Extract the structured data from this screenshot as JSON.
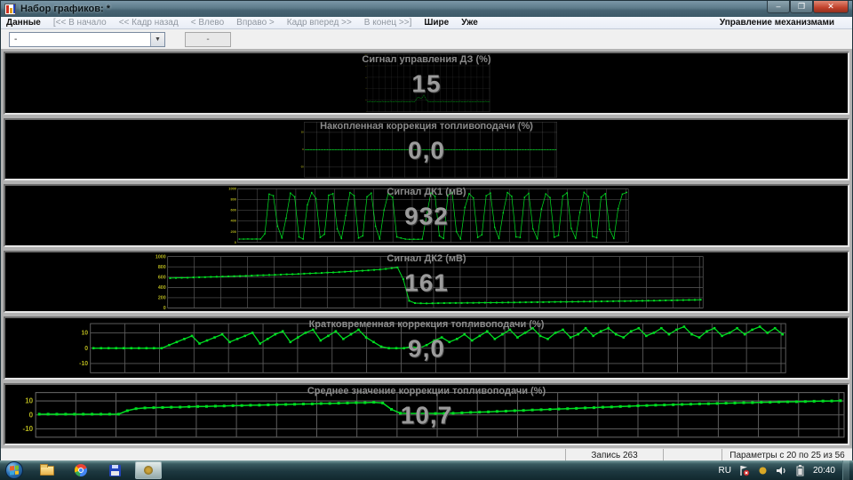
{
  "window": {
    "title": "Набор графиков: *",
    "controls": {
      "minimize": "–",
      "maximize": "❐",
      "close": "✕"
    }
  },
  "menu": {
    "items": [
      {
        "key": "dannye",
        "label": "Данные",
        "enabled": true
      },
      {
        "key": "v-nachalo",
        "label": "[<< В начало",
        "enabled": false
      },
      {
        "key": "kadr-nazad",
        "label": "<< Кадр назад",
        "enabled": false
      },
      {
        "key": "vlevo",
        "label": "< Влево",
        "enabled": false
      },
      {
        "key": "vpravo",
        "label": "Вправо >",
        "enabled": false
      },
      {
        "key": "kadr-vpered",
        "label": "Кадр вперед >>",
        "enabled": false
      },
      {
        "key": "v-konec",
        "label": "В конец >>]",
        "enabled": false
      },
      {
        "key": "shire",
        "label": "Шире",
        "enabled": true
      },
      {
        "key": "uzhe",
        "label": "Уже",
        "enabled": true
      }
    ],
    "right_item": "Управление механизмами"
  },
  "toolbar": {
    "combo_value": "-",
    "combo_arrow": "▼",
    "box_value": "-"
  },
  "colors": {
    "series": "#00dd22",
    "tick_label": "#b6b61e",
    "grid": "#5c5c5c",
    "frame": "#6a6a6a",
    "title": "#8a8a8a",
    "value": "#9b9b9b"
  },
  "chart_data": [
    {
      "type": "line",
      "title": "Сигнал управления ДЗ  (%)",
      "current_value": "15",
      "ylim": [
        0,
        100
      ],
      "yticks": [
        100,
        80,
        60,
        40,
        20,
        0
      ],
      "grid": true,
      "legend": "none",
      "values": [
        17,
        17,
        18,
        17,
        17,
        17,
        18,
        17,
        17,
        17,
        17,
        18,
        17,
        17,
        17,
        17,
        17,
        18,
        17,
        17,
        17,
        18,
        17,
        17,
        17,
        17,
        18,
        17,
        17,
        17,
        17,
        17,
        17,
        18,
        17,
        17,
        20,
        24,
        25,
        24,
        23,
        25,
        29,
        25,
        20,
        18,
        17,
        17,
        17,
        17,
        18,
        17,
        17,
        17,
        17,
        17,
        18,
        17,
        17,
        17,
        17,
        17,
        17,
        18,
        17,
        17,
        17,
        17,
        17,
        18,
        17,
        17,
        17,
        17,
        17,
        18,
        17,
        17,
        17,
        17,
        17,
        17,
        18,
        17,
        17,
        17,
        17,
        17,
        18,
        17,
        17,
        17
      ]
    },
    {
      "type": "line",
      "title": "Накопленная коррекция топливоподачи  (%)",
      "current_value": "0,0",
      "ylim": [
        -16,
        16
      ],
      "yticks": [
        10,
        0,
        -10
      ],
      "grid": true,
      "legend": "none",
      "values": [
        0,
        0,
        0,
        0,
        0,
        0,
        0,
        0,
        0,
        0,
        0,
        0,
        0,
        0,
        0,
        0,
        0,
        0,
        0,
        0,
        0,
        0,
        0,
        0,
        0,
        0,
        0,
        0,
        0,
        0,
        0,
        0,
        0,
        0,
        0,
        0,
        0,
        0,
        0,
        0,
        0,
        0,
        0,
        0,
        0,
        0,
        0,
        0,
        0,
        0,
        0,
        0,
        0,
        0,
        0,
        0,
        0,
        0,
        0,
        0,
        0,
        0,
        0,
        0,
        0,
        0,
        0,
        0,
        0,
        0,
        0,
        0,
        0,
        0,
        0,
        0,
        0,
        0,
        0,
        0,
        0,
        0,
        0,
        0,
        0,
        0,
        0,
        0,
        0,
        0,
        0,
        0
      ]
    },
    {
      "type": "line",
      "title": "Сигнал ДК1  (мВ)",
      "current_value": "932",
      "ylim": [
        0,
        1000
      ],
      "yticks": [
        1000,
        800,
        600,
        400,
        200,
        0
      ],
      "grid": true,
      "legend": "none",
      "values": [
        60,
        60,
        62,
        60,
        61,
        60,
        160,
        900,
        870,
        300,
        80,
        450,
        920,
        850,
        100,
        60,
        700,
        930,
        820,
        90,
        150,
        880,
        910,
        250,
        70,
        500,
        930,
        870,
        80,
        120,
        850,
        920,
        300,
        60,
        600,
        910,
        840,
        100,
        80,
        60,
        55,
        58,
        56,
        60,
        500,
        920,
        860,
        120,
        70,
        880,
        930,
        200,
        60,
        650,
        910,
        830,
        90,
        140,
        870,
        920,
        280,
        70,
        550,
        930,
        860,
        100,
        90,
        840,
        915,
        250,
        65,
        620,
        905,
        835,
        95,
        130,
        865,
        925,
        260,
        75,
        560,
        935,
        855,
        110,
        85,
        845,
        910,
        240,
        70,
        630,
        900,
        932
      ]
    },
    {
      "type": "line",
      "title": "Сигнал ДК2  (мВ)",
      "current_value": "161",
      "ylim": [
        0,
        1000
      ],
      "yticks": [
        1000,
        800,
        600,
        400,
        200,
        0
      ],
      "grid": true,
      "legend": "none",
      "values": [
        580,
        585,
        588,
        590,
        595,
        598,
        600,
        605,
        608,
        612,
        615,
        618,
        622,
        625,
        630,
        635,
        638,
        642,
        645,
        650,
        655,
        658,
        662,
        668,
        672,
        678,
        682,
        688,
        692,
        698,
        705,
        712,
        718,
        725,
        732,
        740,
        748,
        760,
        775,
        790,
        560,
        140,
        95,
        92,
        90,
        92,
        94,
        95,
        96,
        98,
        98,
        100,
        100,
        102,
        103,
        104,
        105,
        106,
        108,
        108,
        110,
        112,
        113,
        114,
        115,
        116,
        118,
        119,
        120,
        122,
        123,
        125,
        126,
        128,
        129,
        130,
        132,
        134,
        135,
        137,
        138,
        140,
        142,
        144,
        146,
        148,
        150,
        152,
        154,
        156,
        158,
        161
      ]
    },
    {
      "type": "line",
      "title": "Кратковременная коррекция топливоподачи  (%)",
      "current_value": "9,0",
      "ylim": [
        -16,
        16
      ],
      "yticks": [
        10,
        0,
        -10
      ],
      "grid": true,
      "legend": "none",
      "values": [
        0,
        0,
        0,
        0,
        0,
        0,
        0,
        0,
        0,
        0,
        2,
        4,
        6,
        8,
        3,
        5,
        7,
        9,
        4,
        6,
        8,
        10,
        3,
        6,
        9,
        11,
        4,
        7,
        10,
        12,
        5,
        8,
        11,
        6,
        9,
        12,
        7,
        4,
        1,
        0,
        0,
        0,
        1,
        0,
        2,
        5,
        7,
        4,
        6,
        9,
        5,
        8,
        11,
        6,
        9,
        12,
        7,
        10,
        13,
        8,
        6,
        10,
        12,
        7,
        9,
        13,
        8,
        11,
        13,
        9,
        7,
        11,
        13,
        8,
        10,
        13,
        9,
        12,
        14,
        9,
        7,
        11,
        13,
        8,
        10,
        13,
        9,
        12,
        14,
        10,
        13,
        9
      ]
    },
    {
      "type": "line",
      "title": "Среднее значение коррекции топливоподачи  (%)",
      "current_value": "10,7",
      "ylim": [
        -16,
        16
      ],
      "yticks": [
        10,
        0,
        -10
      ],
      "grid": true,
      "legend": "none",
      "values": [
        0.5,
        0.5,
        0.5,
        0.5,
        0.5,
        0.5,
        0.5,
        0.5,
        0.5,
        0.5,
        3,
        4.5,
        5,
        5.2,
        5.3,
        5.5,
        5.6,
        5.8,
        6,
        6.1,
        6.3,
        6.4,
        6.6,
        6.7,
        6.9,
        7,
        7.2,
        7.3,
        7.5,
        7.6,
        7.8,
        7.9,
        8.1,
        8.2,
        8.4,
        8.5,
        8.7,
        8.8,
        9,
        8.5,
        4,
        1.2,
        1,
        1,
        1.1,
        1,
        1.1,
        1.2,
        1.5,
        1.8,
        2,
        2.2,
        2.5,
        2.7,
        3,
        3.2,
        3.5,
        3.7,
        4,
        4.2,
        4.5,
        4.7,
        5,
        5.2,
        5.5,
        5.7,
        6,
        6.2,
        6.5,
        6.7,
        7,
        7.1,
        7.3,
        7.5,
        7.7,
        7.9,
        8,
        8.2,
        8.4,
        8.5,
        8.7,
        8.8,
        9,
        9.1,
        9.3,
        9.4,
        9.5,
        9.6,
        9.8,
        9.9,
        10,
        10.2
      ]
    }
  ],
  "statusbar": {
    "record": "Запись 263",
    "params": "Параметры с 20 по 25 из 56"
  },
  "taskbar": {
    "lang": "RU",
    "time": "20:40"
  }
}
